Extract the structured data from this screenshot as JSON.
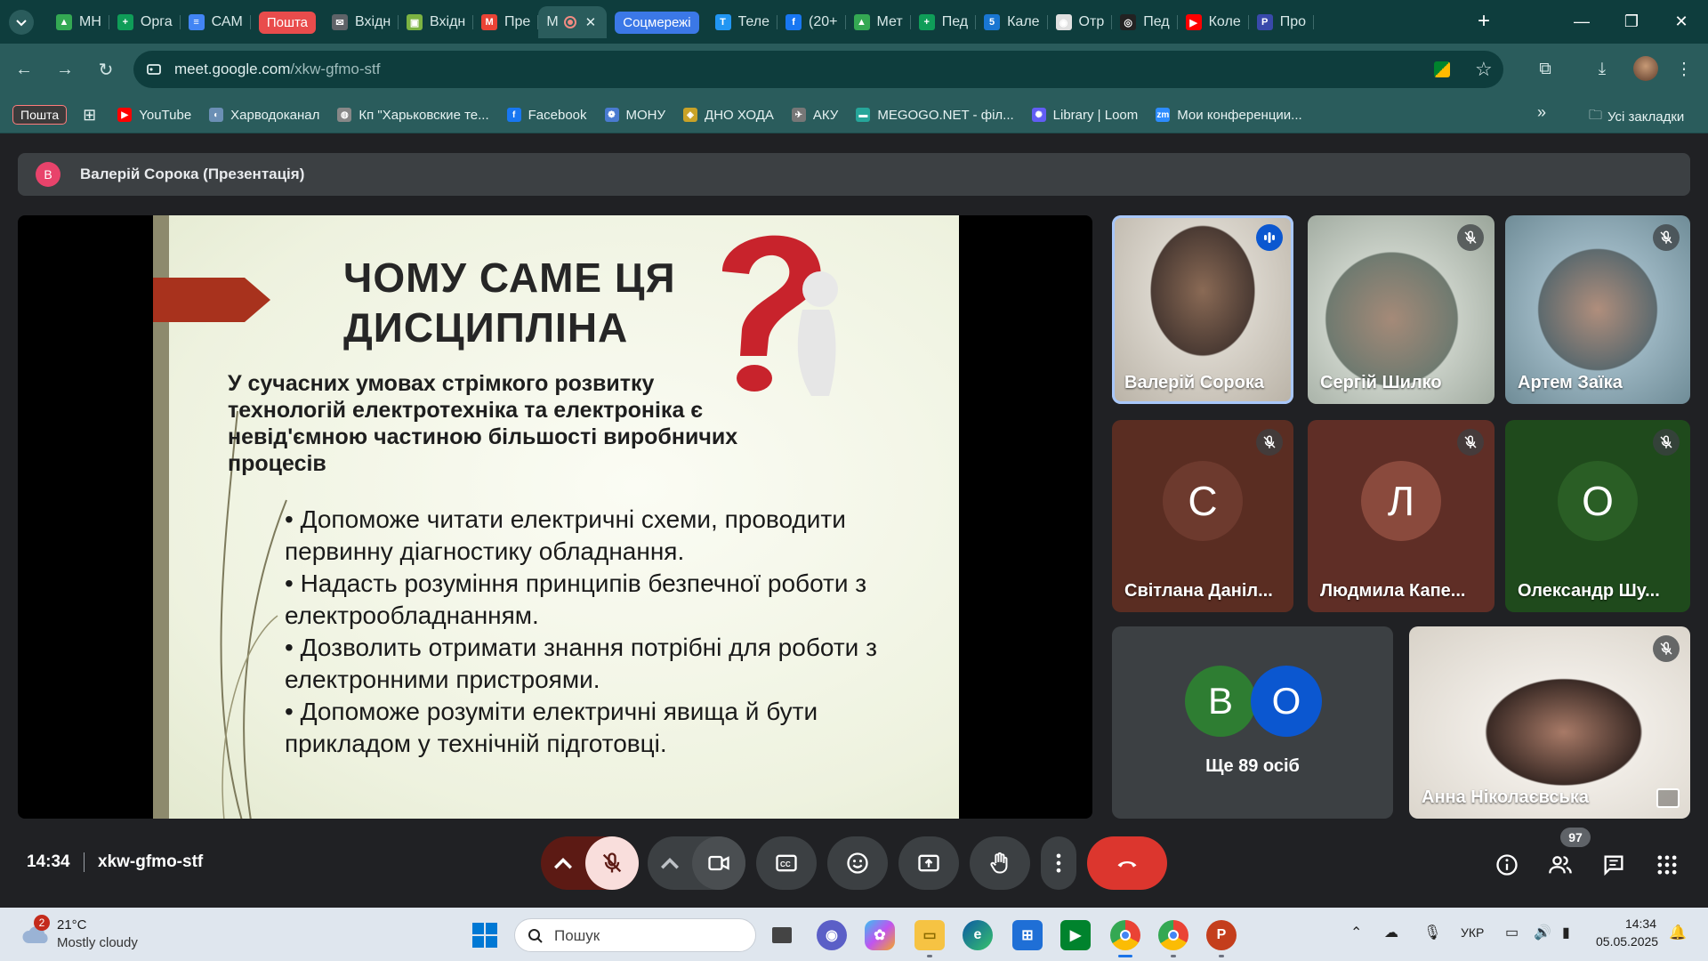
{
  "browser": {
    "tabs": [
      {
        "label": "МН",
        "color": "#34a853",
        "glyph": "▲"
      },
      {
        "label": "Орга",
        "color": "#0f9d58",
        "glyph": "+"
      },
      {
        "label": "САМ",
        "color": "#4285f4",
        "glyph": "≡"
      },
      {
        "label": "Пошта",
        "chip": "red"
      },
      {
        "label": "Вхідні",
        "color": "#5f6368",
        "glyph": "✉"
      },
      {
        "label": "Вхідні",
        "color": "#7cb342",
        "glyph": "▣"
      },
      {
        "label": "Пре",
        "color": "#ea4335",
        "glyph": "M"
      },
      {
        "label": "M",
        "active": true
      },
      {
        "label": "Соцмережі",
        "chip": "blue"
      },
      {
        "label": "Теле",
        "color": "#2196f3",
        "glyph": "T"
      },
      {
        "label": "(20+",
        "color": "#1877f2",
        "glyph": "f"
      },
      {
        "label": "Мет",
        "color": "#34a853",
        "glyph": "▲"
      },
      {
        "label": "Пед",
        "color": "#0f9d58",
        "glyph": "+"
      },
      {
        "label": "Кале",
        "color": "#1976d2",
        "glyph": "5"
      },
      {
        "label": "Отр",
        "color": "#e0e0e0",
        "glyph": "◉"
      },
      {
        "label": "Пед",
        "color": "#222222",
        "glyph": "◎"
      },
      {
        "label": "Коле",
        "color": "#ff0000",
        "glyph": "▶"
      },
      {
        "label": "Про",
        "color": "#3949ab",
        "glyph": "Р"
      }
    ],
    "url_host": "meet.google.com",
    "url_path": "/xkw-gfmo-stf",
    "bookmarks_chip": "Пошта",
    "bookmarks": [
      {
        "label": "YouTube",
        "color": "#ff0000",
        "glyph": "▶"
      },
      {
        "label": "Харводоканал",
        "color": "#6b8fb5",
        "glyph": "◐"
      },
      {
        "label": "Кп \"Харьковские те...",
        "color": "#888888",
        "glyph": "◍"
      },
      {
        "label": "Facebook",
        "color": "#1877f2",
        "glyph": "f"
      },
      {
        "label": "МОНУ",
        "color": "#4a7bd1",
        "glyph": "❁"
      },
      {
        "label": "ДНО ХОДА",
        "color": "#c9a227",
        "glyph": "◈"
      },
      {
        "label": "АКУ",
        "color": "#777777",
        "glyph": "✈"
      },
      {
        "label": "MEGOGO.NET - філ...",
        "color": "#26a69a",
        "glyph": "▬"
      },
      {
        "label": "Library | Loom",
        "color": "#625df5",
        "glyph": "✺"
      },
      {
        "label": "Мои конференции...",
        "color": "#2d8cff",
        "glyph": "zm"
      }
    ],
    "all_bookmarks": "Усі закладки"
  },
  "meet": {
    "presenter_initial": "В",
    "presenter_label": "Валерій Сорока (Презентація)",
    "slide": {
      "title": "ЧОМУ САМЕ ЦЯ ДИСЦИПЛІНА",
      "lead": "У сучасних умовах стрімкого розвитку технологій електротехніка та електроніка є невід'ємною частиною більшості виробничих процесів",
      "bullets": [
        "• Допоможе читати електричні схеми, проводити первинну діагностику обладнання.",
        "• Надасть розуміння принципів безпечної роботи з електрообладнанням.",
        "• Дозволить отримати знання потрібні для роботи з електронними пристроями.",
        "• Допоможе розуміти електричні явища й бути прикладом у технічній підготовці."
      ]
    },
    "participants": [
      {
        "name": "Валерій Сорока",
        "type": "video",
        "speaking": true
      },
      {
        "name": "Сергій Шилко",
        "type": "video",
        "muted": true
      },
      {
        "name": "Артем Заїка",
        "type": "video",
        "muted": true
      },
      {
        "name": "Світлана Даніл...",
        "initial": "С",
        "bg": "#5a2d22",
        "avatar": "#6d3a2e",
        "muted": true
      },
      {
        "name": "Людмила Капе...",
        "initial": "Л",
        "bg": "#5f2e26",
        "avatar": "#8a4a3d",
        "muted": true
      },
      {
        "name": "Олександр Шу...",
        "initial": "О",
        "bg": "#1f4a1c",
        "avatar": "#2a5e25",
        "muted": true
      },
      {
        "name": "Анна Ніколаєвська",
        "type": "video",
        "muted": true
      }
    ],
    "others": {
      "initials": [
        "В",
        "О"
      ],
      "colors": [
        "#2e7d32",
        "#0b57d0"
      ],
      "label": "Ще 89 осіб"
    },
    "clock": "14:34",
    "code": "xkw-gfmo-stf",
    "people_count": "97"
  },
  "taskbar": {
    "weather_temp": "21°C",
    "weather_desc": "Mostly cloudy",
    "weather_badge": "2",
    "search_placeholder": "Пошук",
    "lang": "УКР",
    "time": "14:34",
    "date": "05.05.2025"
  }
}
